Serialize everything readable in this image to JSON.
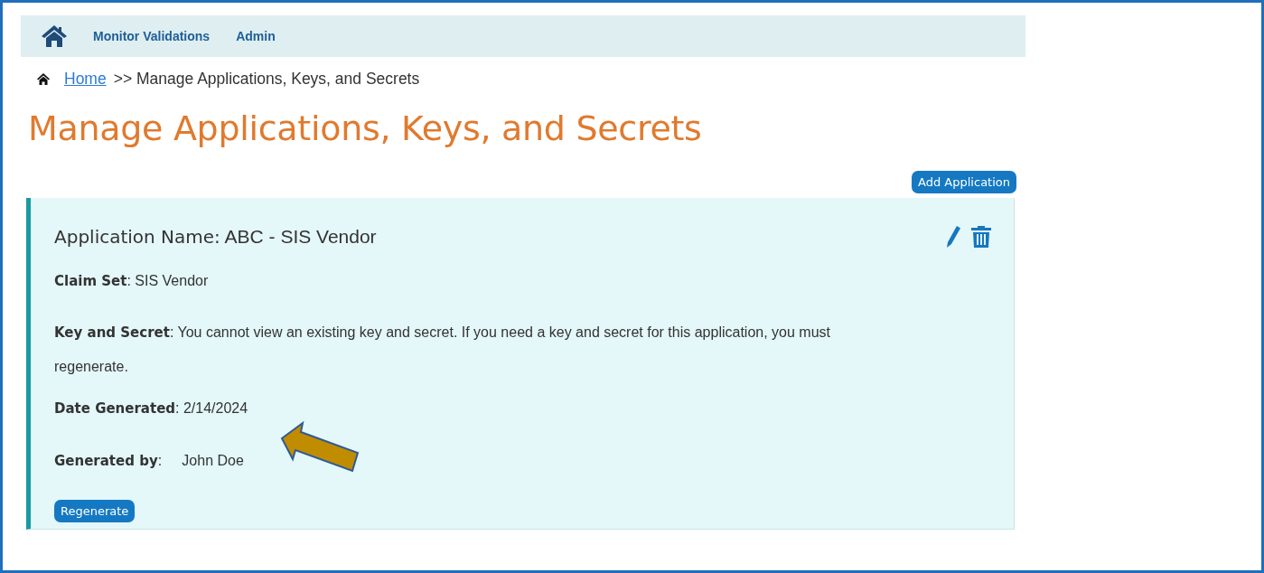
{
  "nav": {
    "links": [
      {
        "label": "Monitor Validations"
      },
      {
        "label": "Admin"
      }
    ]
  },
  "breadcrumb": {
    "link": "Home",
    "current": ">> Manage Applications, Keys, and Secrets"
  },
  "title": "Manage Applications, Keys, and Secrets",
  "add_button": "Add Application",
  "application": {
    "heading": "**Application Name:** ABC - SIS Vendor",
    "fields": [
      {
        "text": "**Claim Set**: SIS Vendor"
      },
      {
        "text": "**Key and Secret**: You cannot view an existing key and secret. If you need a key and secret for this application, you must regenerate."
      },
      {
        "text": "**Date Generated**: 2/14/2024"
      },
      {
        "text": "**Generated by**:     John Doe"
      }
    ],
    "button": "Regenerate"
  }
}
